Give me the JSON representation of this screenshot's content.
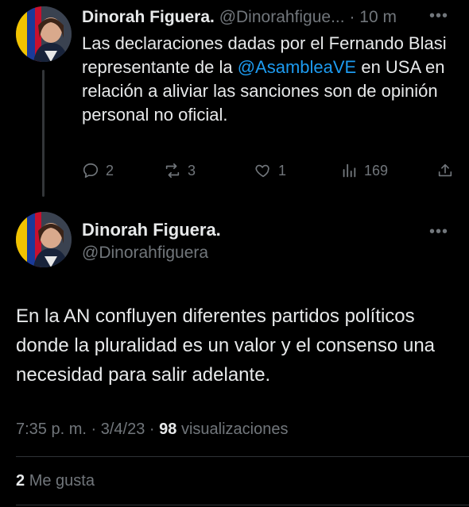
{
  "reply_tweet": {
    "author_name": "Dinorah Figuera.",
    "handle": "@Dinorahfigue...",
    "separator": "·",
    "time": "10 m",
    "text_before_mention": "Las declaraciones dadas por  el Fernando Blasi representante de la",
    "mention": "@AsambleaVE",
    "text_after_mention": " en USA en relación a aliviar las sanciones  son de opinión personal no oficial.",
    "actions": {
      "replies": "2",
      "retweets": "3",
      "likes": "1",
      "views": "169"
    }
  },
  "main_tweet": {
    "author_name": "Dinorah Figuera.",
    "handle": "@Dinorahfiguera",
    "text": "En la AN confluyen diferentes partidos políticos donde la pluralidad es un valor y el consenso una necesidad para salir adelante.",
    "time": "7:35 p. m.",
    "date": "3/4/23",
    "dot": "·",
    "views_count": "98",
    "views_label": "visualizaciones",
    "likes_count": "2",
    "likes_label": "Me gusta"
  },
  "colors": {
    "background": "#000000",
    "text": "#e7e9ea",
    "muted": "#71767b",
    "link": "#1d9bf0",
    "divider": "#2f3336"
  },
  "icons": [
    "reply-icon",
    "retweet-icon",
    "like-icon",
    "views-icon",
    "share-icon",
    "more-icon"
  ]
}
